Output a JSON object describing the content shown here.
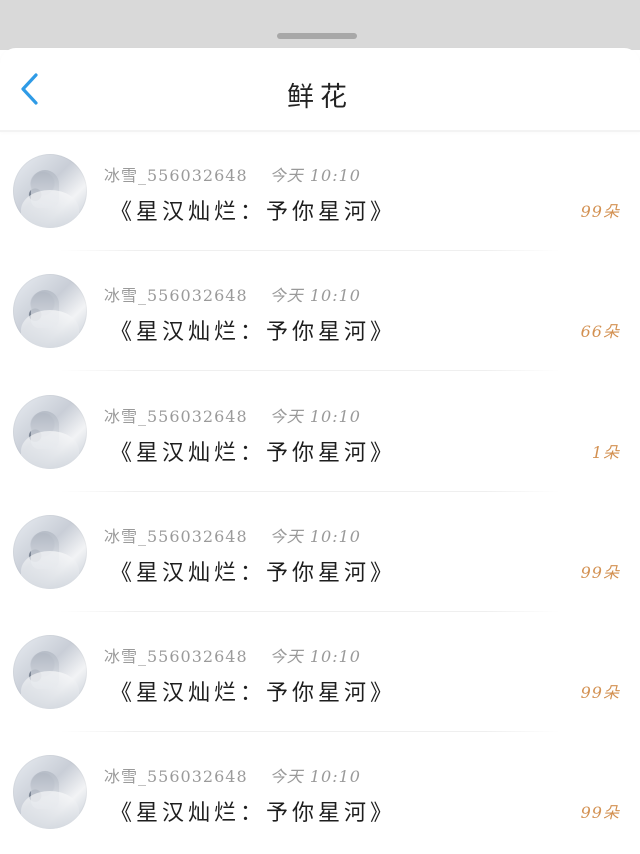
{
  "header": {
    "title": "鲜花"
  },
  "items": [
    {
      "user": "冰雪_556032648",
      "date": "今天",
      "time": "10:10",
      "gift": "《星汉灿烂：予你星河》",
      "count": "99朵"
    },
    {
      "user": "冰雪_556032648",
      "date": "今天",
      "time": "10:10",
      "gift": "《星汉灿烂：予你星河》",
      "count": "66朵"
    },
    {
      "user": "冰雪_556032648",
      "date": "今天",
      "time": "10:10",
      "gift": "《星汉灿烂：予你星河》",
      "count": "1朵"
    },
    {
      "user": "冰雪_556032648",
      "date": "今天",
      "time": "10:10",
      "gift": "《星汉灿烂：予你星河》",
      "count": "99朵"
    },
    {
      "user": "冰雪_556032648",
      "date": "今天",
      "time": "10:10",
      "gift": "《星汉灿烂：予你星河》",
      "count": "99朵"
    },
    {
      "user": "冰雪_556032648",
      "date": "今天",
      "time": "10:10",
      "gift": "《星汉灿烂：予你星河》",
      "count": "99朵"
    }
  ],
  "colors": {
    "accent_blue": "#2f9be6",
    "count_orange": "#d39152"
  }
}
